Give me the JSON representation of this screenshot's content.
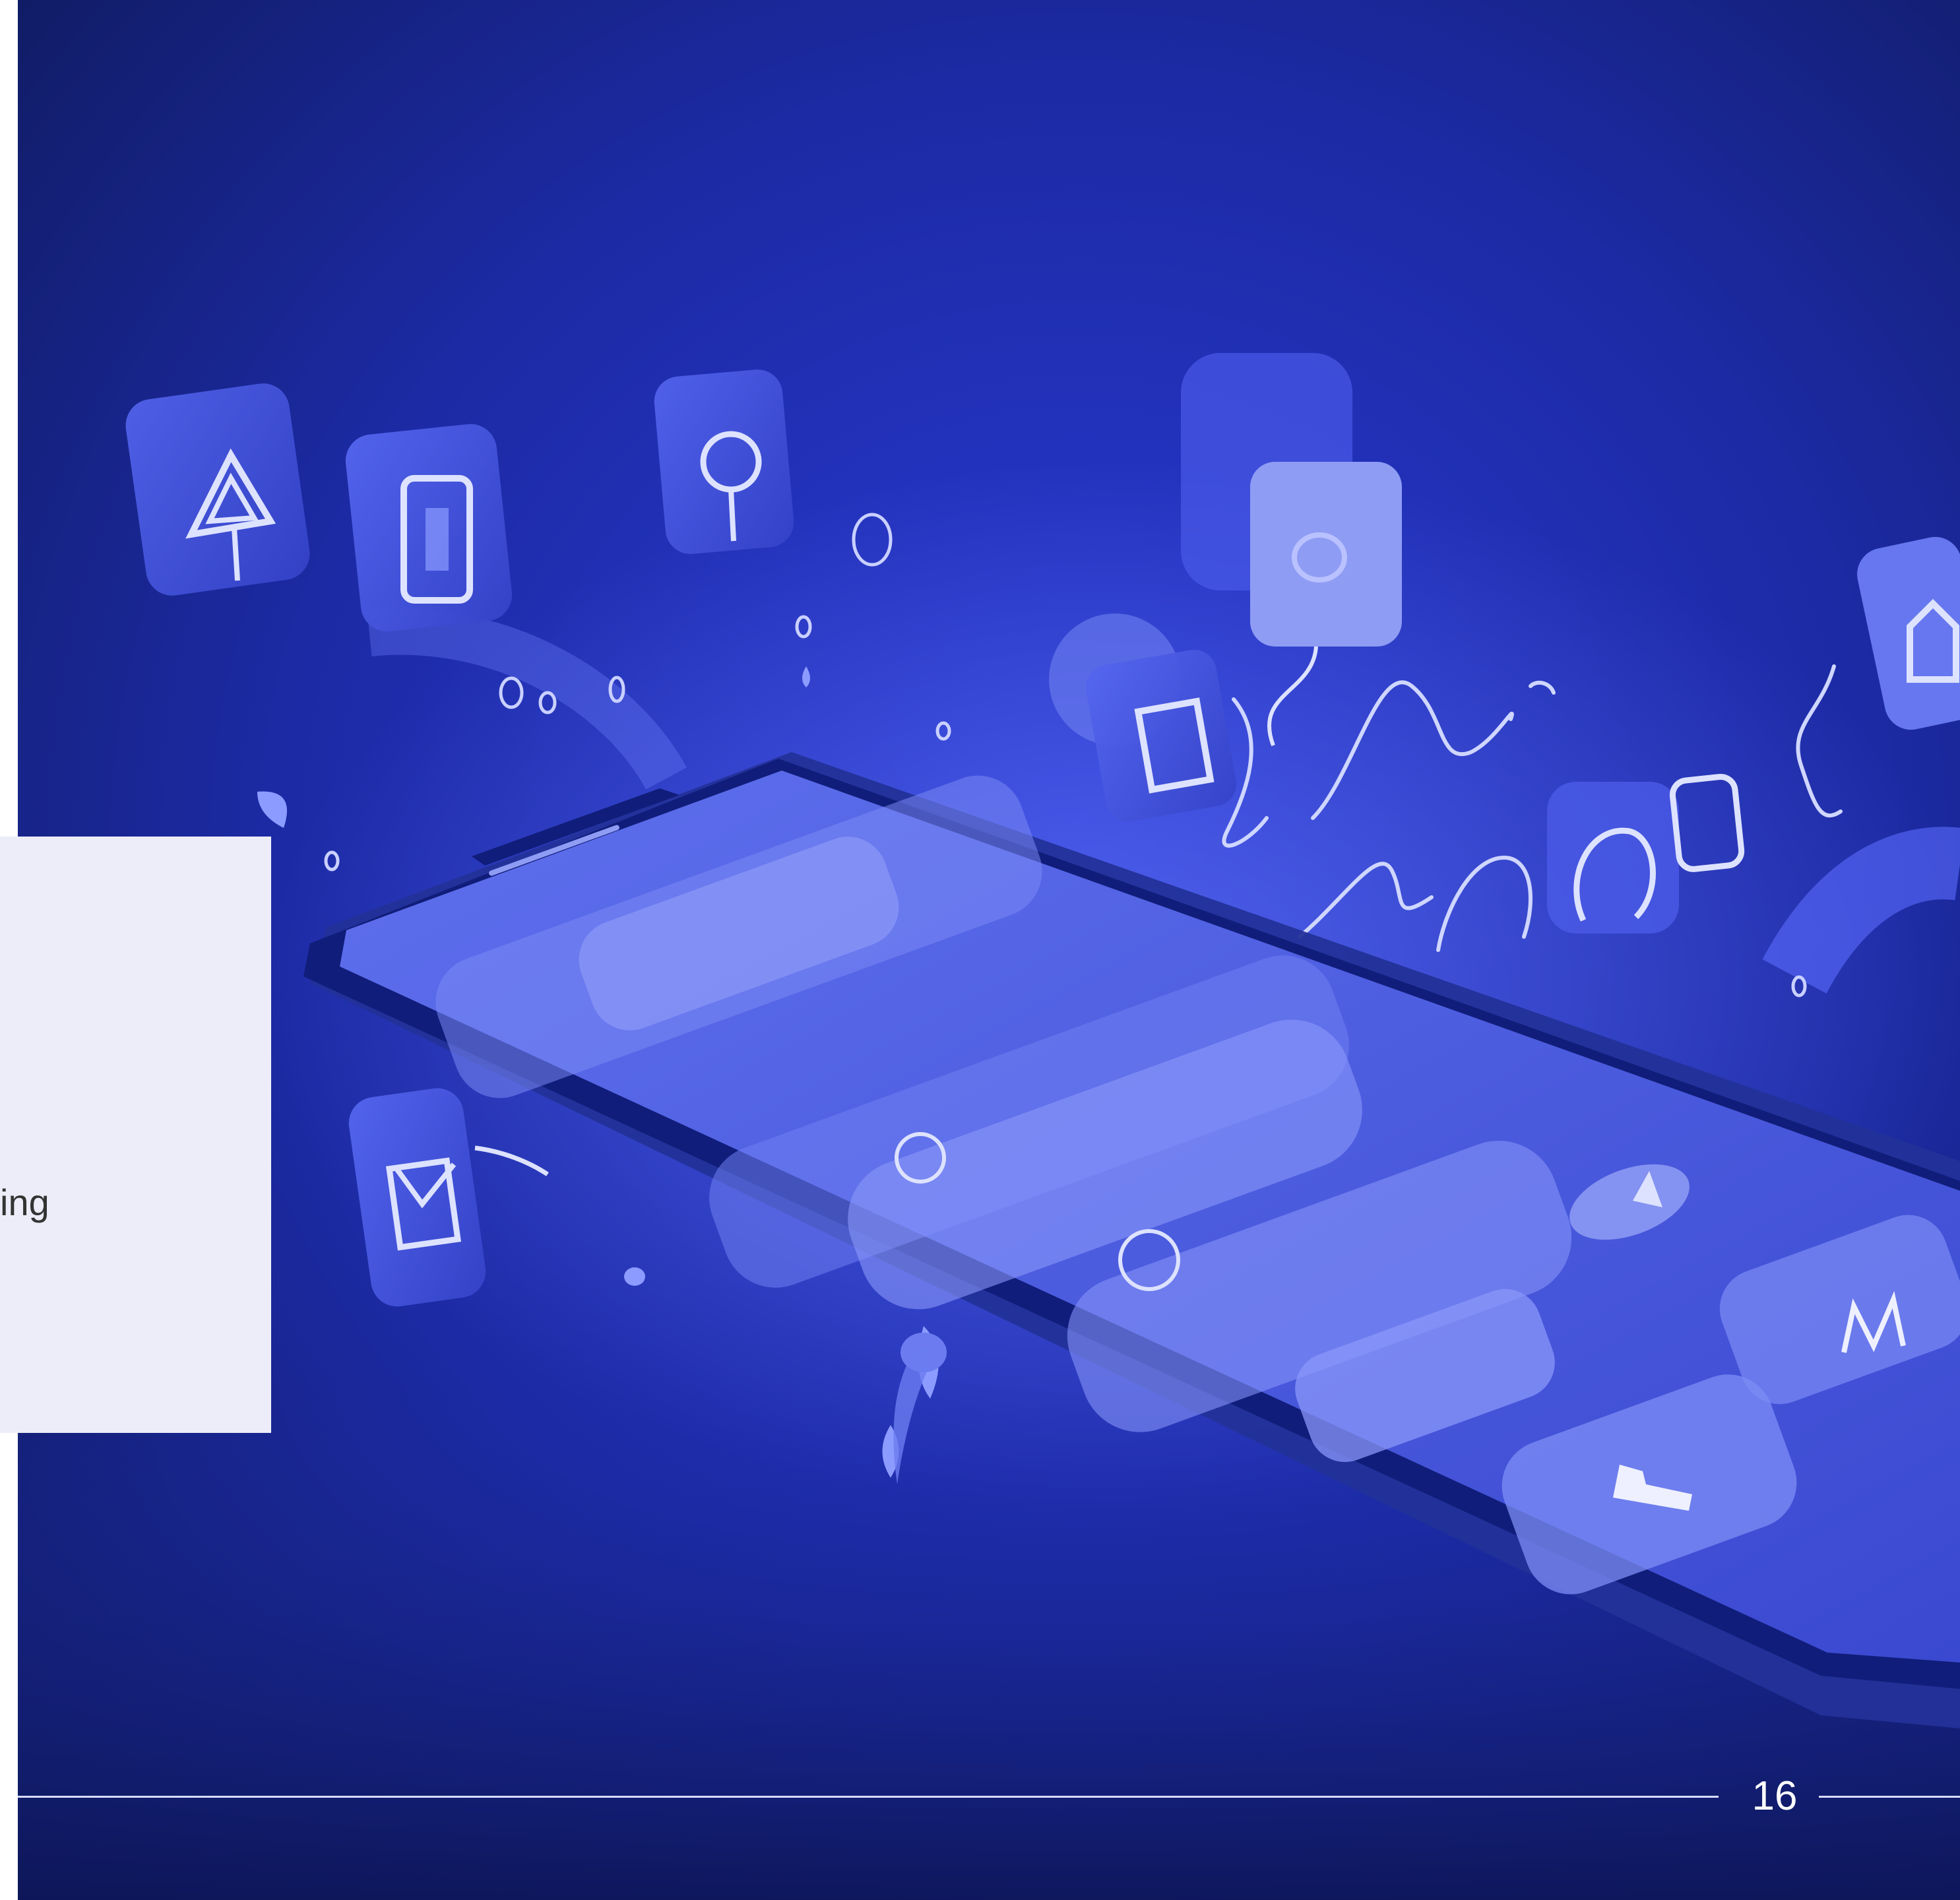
{
  "slide": {
    "card_text": "ing",
    "page_number": "16"
  },
  "icons": [
    "navigation-icon",
    "mobile-device-icon",
    "location-pin-icon",
    "chat-bubble-icon",
    "image-icon",
    "home-icon",
    "email-icon",
    "speech-bubbles-icon"
  ],
  "colors": {
    "background": "#1a2690",
    "background_dark": "#101b5e",
    "accent": "#5b6cff",
    "glow": "#c9d0ff",
    "card": "#ecedf9",
    "card_text": "#333333",
    "footer_text": "#ffffff"
  }
}
